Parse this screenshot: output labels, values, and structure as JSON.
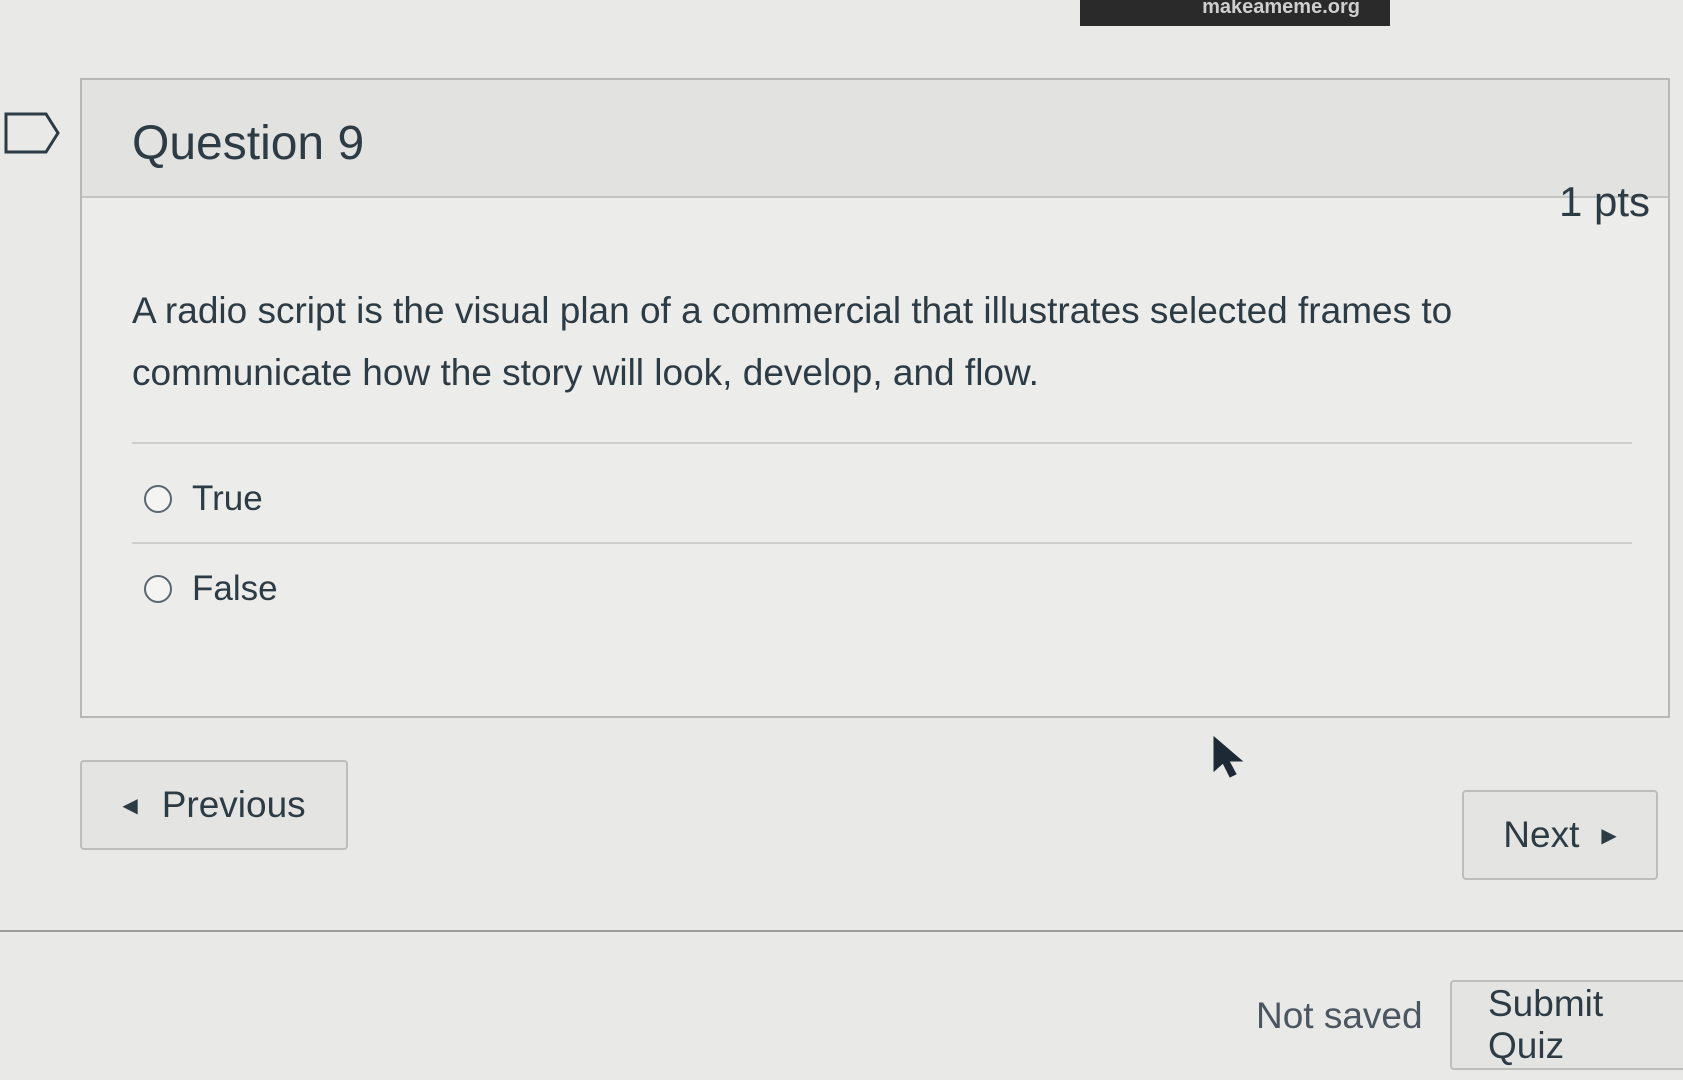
{
  "watermark": "makeameme.org",
  "question": {
    "title": "Question 9",
    "points": "1 pts",
    "text": "A radio script is the visual plan of a commercial that illustrates selected frames to communicate how the story will look, develop, and flow.",
    "options": [
      {
        "label": "True",
        "selected": false
      },
      {
        "label": "False",
        "selected": false
      }
    ]
  },
  "navigation": {
    "previous_label": "Previous",
    "next_label": "Next"
  },
  "footer": {
    "save_status": "Not saved",
    "submit_label": "Submit Quiz"
  },
  "icons": {
    "flag": "flag-question-icon",
    "previous_caret": "caret-left-icon",
    "next_caret": "caret-right-icon",
    "cursor": "mouse-pointer-icon"
  },
  "colors": {
    "text": "#2d3b45",
    "background": "#e9e9e7",
    "border": "#b8b8b6"
  }
}
